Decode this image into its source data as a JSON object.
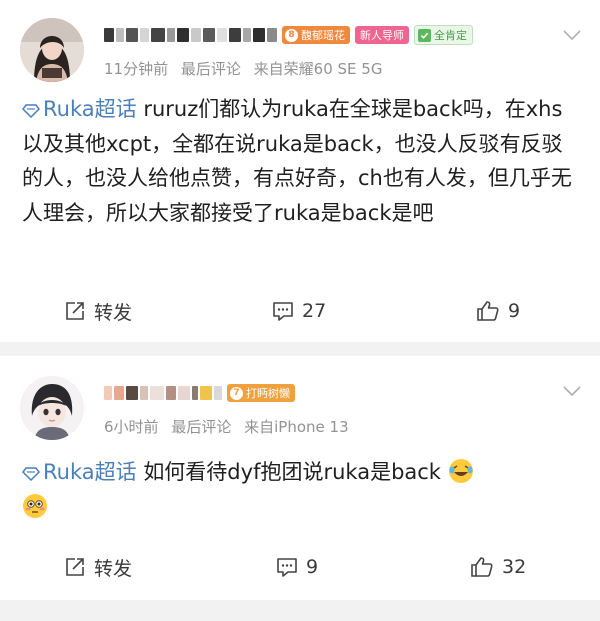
{
  "posts": [
    {
      "username_badges": {
        "fan_level": "8",
        "fan_title": "馥郁瑶花",
        "mentor": "新人导师",
        "verified": "全肯定"
      },
      "time": "11分钟前",
      "last_comment": "最后评论",
      "device": "来自荣耀60 SE 5G",
      "topic": "Ruka超话",
      "body": " ruruz们都认为ruka在全球是back吗，在xhs以及其他xcpt，全都在说ruka是back，也没人反驳有反驳的人，也没人给他点赞，有点好奇，ch也有人发，但几乎无人理会，所以大家都接受了ruka是back是吧",
      "repost_label": "转发",
      "comments": "27",
      "likes": "9"
    },
    {
      "username_badges": {
        "fan_level": "7",
        "fan_title": "打眄树懒"
      },
      "time": "6小时前",
      "last_comment": "最后评论",
      "device": "来自iPhone 13",
      "topic": "Ruka超话",
      "body": "  如何看待dyf抱团说ruka是back ",
      "repost_label": "转发",
      "comments": "9",
      "likes": "32"
    }
  ],
  "icons": {
    "topic": "diamond-supertopic-icon",
    "repost": "repost-icon",
    "comment": "comment-icon",
    "like": "thumbs-up-icon",
    "more": "chevron-down-icon",
    "emoji1": "laughing-tears-emoji",
    "emoji2": "flushed-face-emoji"
  },
  "colors": {
    "link": "#4a7fb8",
    "meta": "#939393",
    "fan_badge": "#f0883e",
    "mentor_badge": "#f06491",
    "verified_badge": "#5cb85c",
    "separator": "#f2f2f2"
  }
}
